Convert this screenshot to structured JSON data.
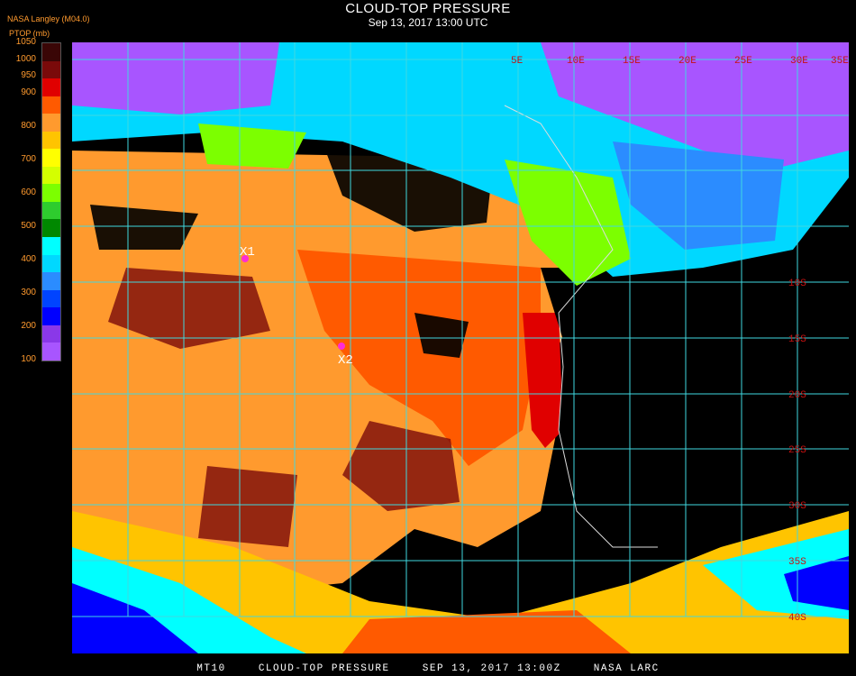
{
  "header": {
    "title": "CLOUD-TOP PRESSURE",
    "datetime": "Sep 13, 2017 13:00 UTC",
    "organization": "NASA Langley (M04.0)",
    "unit": "PTOP (mb)"
  },
  "legend": {
    "ticks": [
      "1050",
      "1000",
      "950",
      "900",
      "850",
      "800",
      "750",
      "700",
      "650",
      "600",
      "550",
      "500",
      "450",
      "400",
      "350",
      "300",
      "250",
      "200",
      "150",
      "100"
    ],
    "labels": [
      "1050",
      "1000",
      "950",
      "900",
      "800",
      "700",
      "600",
      "500",
      "400",
      "300",
      "200",
      "100"
    ],
    "colors": [
      "#3a0606",
      "#7a0a0a",
      "#e00000",
      "#ff5a00",
      "#ff9a2e",
      "#ffc400",
      "#ffff00",
      "#d4ff00",
      "#7cff00",
      "#2ecc2e",
      "#008800",
      "#00ffff",
      "#00d8ff",
      "#2b8cff",
      "#0044ff",
      "#0000ff",
      "#8a38e8",
      "#a855ff"
    ]
  },
  "map": {
    "grid_lat_labels": [
      "10S",
      "15S",
      "20S",
      "25S",
      "30S",
      "35S",
      "40S"
    ],
    "grid_lon_labels": [
      "5E",
      "10E",
      "15E",
      "20E",
      "25E",
      "30E",
      "35E"
    ],
    "markers": [
      {
        "label": "X1",
        "color": "#ff2bd6"
      },
      {
        "label": "X2",
        "color": "#ff2bd6"
      }
    ]
  },
  "footer": {
    "sat": "MT10",
    "product": "CLOUD-TOP PRESSURE",
    "date": "SEP 13, 2017 13:00Z",
    "source": "NASA LARC"
  }
}
